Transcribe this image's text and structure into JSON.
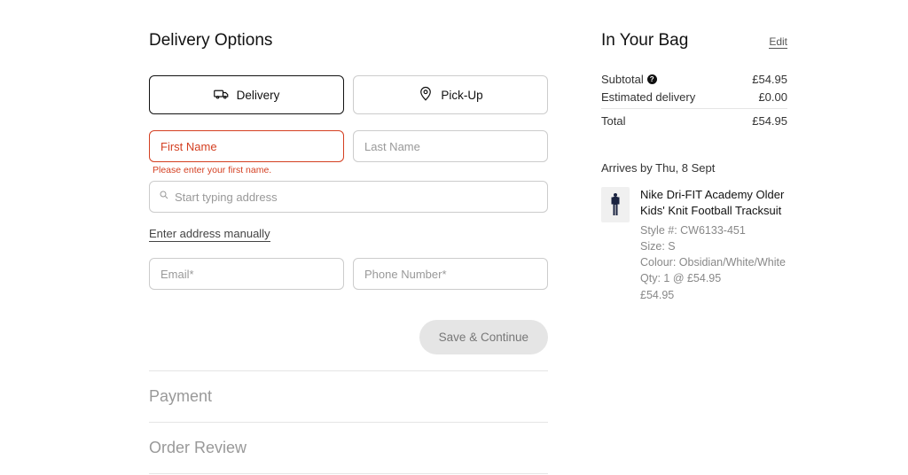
{
  "left": {
    "title": "Delivery Options",
    "tabs": {
      "delivery": "Delivery",
      "pickup": "Pick-Up"
    },
    "fields": {
      "first_name_placeholder": "First Name",
      "first_name_error": "Please enter your first name.",
      "last_name_placeholder": "Last Name",
      "address_placeholder": "Start typing address",
      "manual_link": "Enter address manually",
      "email_placeholder": "Email*",
      "phone_placeholder": "Phone Number*"
    },
    "save_button": "Save & Continue",
    "steps": {
      "payment": "Payment",
      "order_review": "Order Review"
    }
  },
  "right": {
    "title": "In Your Bag",
    "edit": "Edit",
    "summary": {
      "subtotal_label": "Subtotal",
      "subtotal_value": "£54.95",
      "delivery_label": "Estimated delivery",
      "delivery_value": "£0.00",
      "total_label": "Total",
      "total_value": "£54.95"
    },
    "arrives": "Arrives by Thu, 8 Sept",
    "item": {
      "name": "Nike Dri-FIT Academy Older Kids' Knit Football Tracksuit",
      "style": "Style #: CW6133-451",
      "size": "Size: S",
      "colour": "Colour: Obsidian/White/White",
      "qty": "Qty: 1 @ £54.95",
      "price": "£54.95"
    }
  }
}
